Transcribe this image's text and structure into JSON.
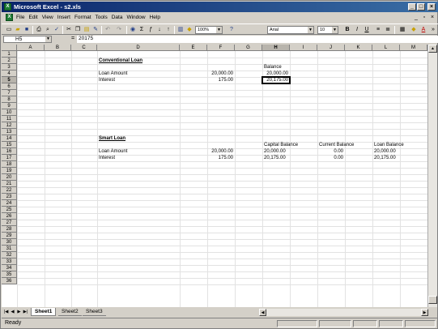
{
  "window": {
    "title": "Microsoft Excel - s2.xls",
    "app_icon": "excel-icon",
    "controls": [
      "minimize",
      "maximize",
      "close"
    ]
  },
  "menubar": {
    "items": [
      "File",
      "Edit",
      "View",
      "Insert",
      "Format",
      "Tools",
      "Data",
      "Window",
      "Help"
    ],
    "doc_controls": [
      "minimize",
      "restore",
      "close"
    ]
  },
  "toolbar": {
    "zoom": "100%",
    "font": "Arial",
    "font_size": "10",
    "help_value": "?"
  },
  "formula_bar": {
    "name_box": "H5",
    "equals": "=",
    "formula": "20175"
  },
  "grid": {
    "columns": [
      "A",
      "B",
      "C",
      "D",
      "E",
      "F",
      "G",
      "H",
      "I",
      "J",
      "K",
      "L",
      "M",
      "N"
    ],
    "rows": [
      "1",
      "2",
      "3",
      "4",
      "5",
      "6",
      "7",
      "8",
      "9",
      "10",
      "11",
      "12",
      "13",
      "14",
      "15",
      "16",
      "17",
      "18",
      "19",
      "20",
      "21",
      "22",
      "23",
      "24",
      "25",
      "26",
      "27",
      "28",
      "29",
      "30",
      "31",
      "32",
      "33",
      "34",
      "35",
      "36"
    ],
    "selected_col": "H",
    "selected_row": "5",
    "cells": {
      "d2": "Conventional Loan",
      "h3": "Balance",
      "d4": "Loan Amount",
      "f4": "20,000.00",
      "h4": "20,000.00",
      "d5": "Interest",
      "f5": "175.00",
      "h5": "20,175.00",
      "d14": "Smart Loan",
      "h15": "Capital Balance",
      "j15": "Current Balance",
      "l15": "Loan Balance",
      "d16": "Loan Amount",
      "f16": "20,000.00",
      "h16": "20,000.00",
      "j16": "0.00",
      "l16": "20,000.00",
      "d17": "Interest",
      "f17": "175.00",
      "h17": "20,175.00",
      "j17": "0.00",
      "l17": "20,175.00"
    }
  },
  "sheets": {
    "tabs": [
      "Sheet1",
      "Sheet2",
      "Sheet3"
    ],
    "active": "Sheet1"
  },
  "status": {
    "text": "Ready"
  }
}
